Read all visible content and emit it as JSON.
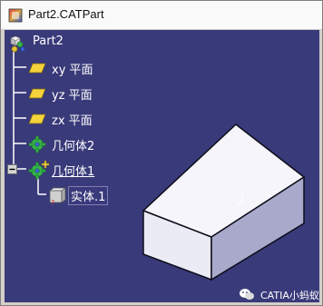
{
  "window": {
    "title": "Part2.CATPart"
  },
  "tree": {
    "root": {
      "label": "Part2"
    },
    "planes": [
      {
        "label": "xy 平面"
      },
      {
        "label": "yz 平面"
      },
      {
        "label": "zx 平面"
      }
    ],
    "bodies": [
      {
        "label": "几何体2"
      },
      {
        "label": "几何体1"
      }
    ],
    "solid": {
      "label": "实体.1"
    }
  },
  "watermark": {
    "text": "CATIA小蚂蚁"
  },
  "colors": {
    "background": "#393a7a",
    "box_top": "#f5f5fb",
    "box_front": "#ebebf5",
    "box_side": "#a9a9cc",
    "plane_icon": "#f3d23c"
  }
}
